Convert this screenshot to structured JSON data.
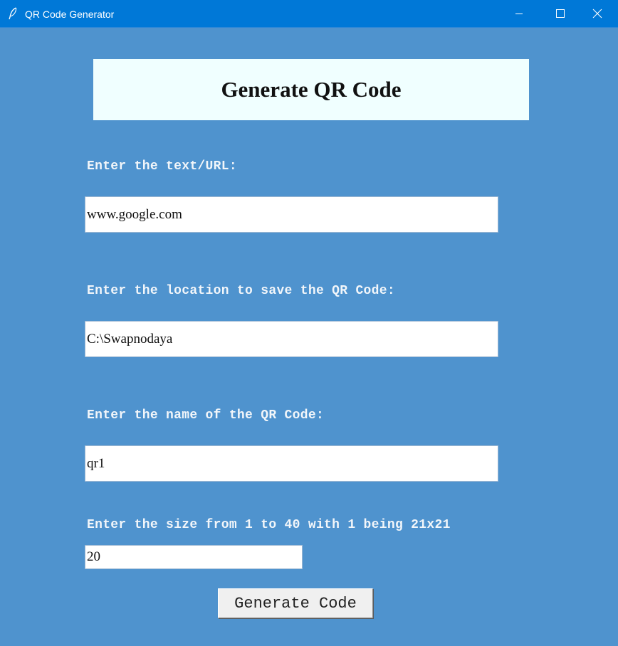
{
  "window": {
    "title": "QR Code Generator",
    "icons": {
      "app": "feather-icon",
      "minimize": "minimize-icon",
      "maximize": "maximize-icon",
      "close": "close-icon"
    },
    "colors": {
      "titlebar": "#0078d7",
      "background": "#4f93ce",
      "header_box": "#f0ffff"
    }
  },
  "header": {
    "title": "Generate QR Code"
  },
  "form": {
    "text_label": "Enter the text/URL:",
    "text_value": "www.google.com",
    "location_label": "Enter the location to save the QR Code:",
    "location_value": "C:\\Swapnodaya",
    "name_label": "Enter the name of the QR Code:",
    "name_value": "qr1",
    "size_label": "Enter the size from 1 to 40 with 1 being 21x21",
    "size_value": "20",
    "generate_label": "Generate Code"
  }
}
